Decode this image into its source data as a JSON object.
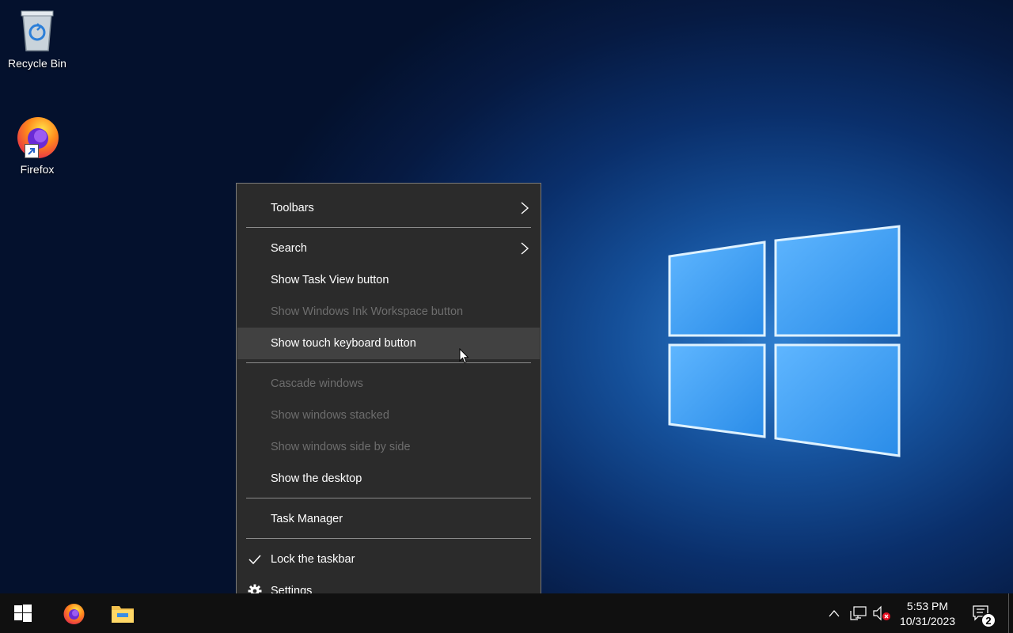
{
  "desktop": {
    "icons": [
      {
        "label": "Recycle Bin",
        "icon": "recycle-bin-icon"
      },
      {
        "label": "Firefox",
        "icon": "firefox-icon"
      }
    ]
  },
  "context_menu": {
    "items": [
      {
        "label": "Toolbars",
        "submenu": true
      },
      {
        "label": "Search",
        "submenu": true
      },
      {
        "label": "Show Task View button"
      },
      {
        "label": "Show Windows Ink Workspace button",
        "disabled": true
      },
      {
        "label": "Show touch keyboard button",
        "hovered": true
      },
      {
        "label": "Cascade windows",
        "disabled": true
      },
      {
        "label": "Show windows stacked",
        "disabled": true
      },
      {
        "label": "Show windows side by side",
        "disabled": true
      },
      {
        "label": "Show the desktop"
      },
      {
        "label": "Task Manager"
      },
      {
        "label": "Lock the taskbar",
        "checked": true
      },
      {
        "label": "Settings",
        "icon": "gear-icon"
      }
    ]
  },
  "taskbar": {
    "time": "5:53 PM",
    "date": "10/31/2023",
    "notification_count": "2"
  },
  "colors": {
    "menu_bg": "#2b2b2b",
    "menu_hover": "#414141",
    "disabled_text": "#6d6d6d",
    "taskbar_bg": "#101010"
  }
}
